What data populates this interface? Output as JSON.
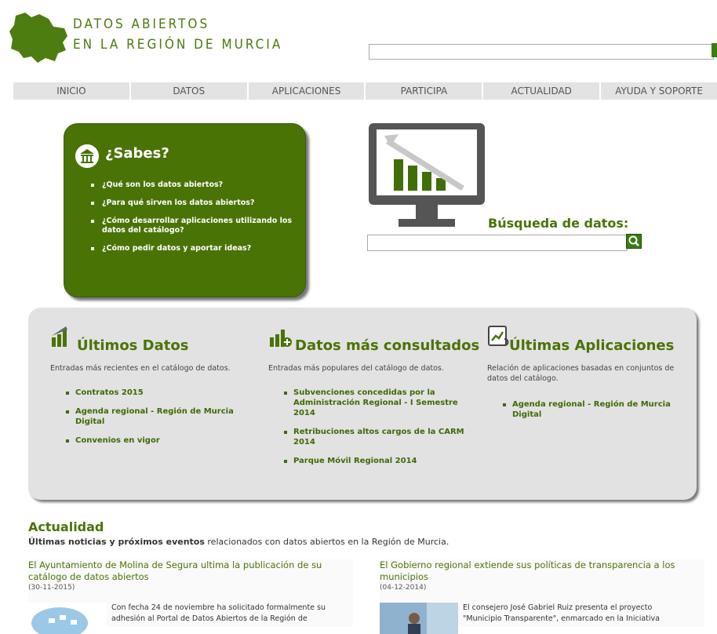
{
  "header": {
    "logo_line1": "DATOS ABIERTOS",
    "logo_line2": "EN LA REGIÓN DE MURCIA",
    "search_placeholder": ""
  },
  "nav": {
    "items": [
      "INICIO",
      "DATOS",
      "APLICACIONES",
      "PARTICIPA",
      "ACTUALIDAD",
      "AYUDA Y SOPORTE"
    ]
  },
  "sabes": {
    "title": "¿Sabes?",
    "items": [
      "¿Qué son los datos abiertos?",
      "¿Para qué sirven los datos abiertos?",
      "¿Cómo desarrollar aplicaciones utilizando los datos del catálogo?",
      "¿Cómo pedir datos y aportar ideas?"
    ]
  },
  "busqueda": {
    "label": "Búsqueda de datos:",
    "placeholder": ""
  },
  "ultimos": {
    "title": "Últimos Datos",
    "desc": "Entradas más recientes en el catálogo de datos.",
    "items": [
      "Contratos 2015",
      "Agenda regional - Región de Murcia Digital",
      "Convenios en vigor"
    ]
  },
  "consultados": {
    "title": "Datos más consultados",
    "desc": "Entradas más populares del catálogo de datos.",
    "items": [
      "Subvenciones concedidas por la Administración Regional - I Semestre 2014",
      "Retribuciones altos cargos de la CARM 2014",
      "Parque Móvil Regional 2014"
    ]
  },
  "aplicaciones": {
    "title": "Últimas Aplicaciones",
    "desc": "Relación de aplicaciones basadas en conjuntos de datos del catálogo.",
    "items": [
      "Agenda regional - Región de Murcia Digital"
    ]
  },
  "actualidad": {
    "title": "Actualidad",
    "sub_bold": "Últimas noticias y próximos eventos",
    "sub_rest": " relacionados con datos abiertos en la Región de Murcia."
  },
  "news": [
    {
      "title": "El Ayuntamiento de Molina de Segura ultima la publicación de su catálogo de datos abiertos",
      "date": "(30-11-2015)",
      "text": "Con fecha 24 de noviembre ha solicitado formalmente su adhesión al Portal de Datos Abiertos de la Región de"
    },
    {
      "title": "El Gobierno regional extiende sus políticas de transparencia a los municipios",
      "date": "(04-12-2014)",
      "text": "El consejero José Gabriel Ruiz presenta el proyecto \"Municipio Transparente\", enmarcado en la Iniciativa"
    }
  ]
}
